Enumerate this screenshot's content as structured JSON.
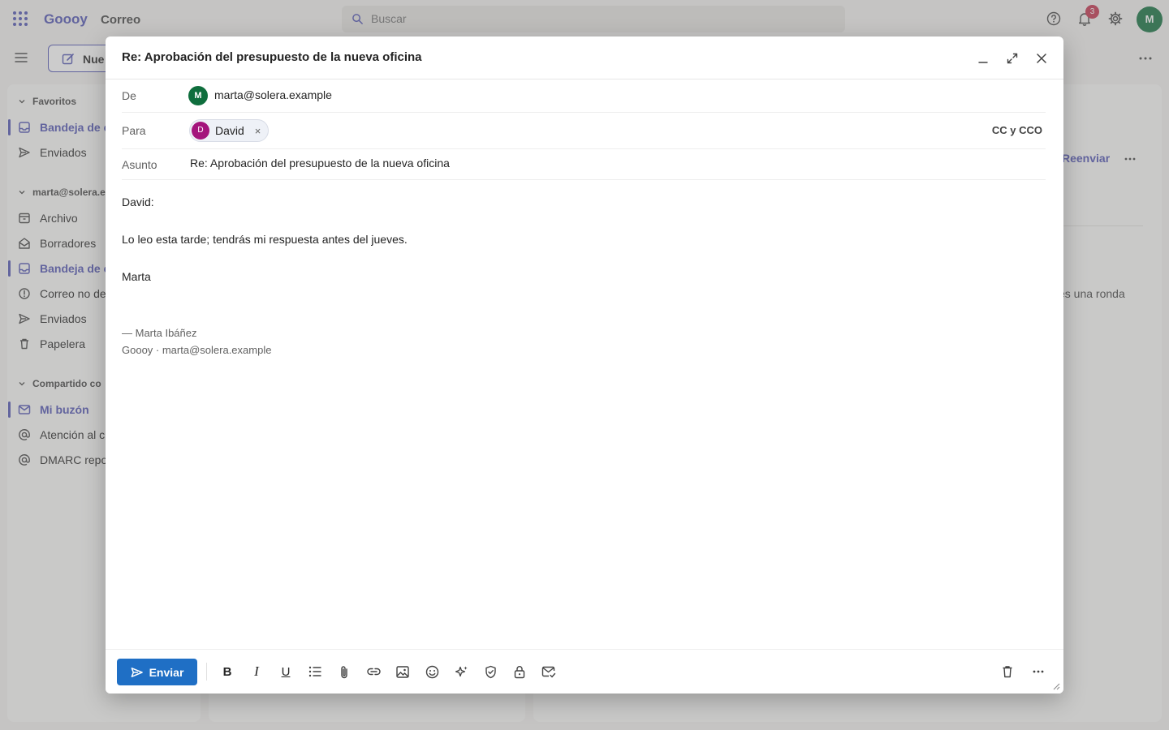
{
  "app": {
    "brand": "Goooy",
    "name": "Correo",
    "search_placeholder": "Buscar",
    "notifications_count": "3",
    "user_initial": "M",
    "new_button": "Nue"
  },
  "nav": {
    "favorites_header": "Favoritos",
    "favorites": [
      {
        "label": "Bandeja de e"
      },
      {
        "label": "Enviados"
      }
    ],
    "account_header": "marta@solera.e",
    "account_items": [
      {
        "label": "Archivo"
      },
      {
        "label": "Borradores"
      },
      {
        "label": "Bandeja de e"
      },
      {
        "label": "Correo no de"
      },
      {
        "label": "Enviados"
      },
      {
        "label": "Papelera"
      }
    ],
    "shared_header": "Compartido co",
    "shared_items": [
      {
        "label": "Mi buzón"
      },
      {
        "label": "Atención al cl"
      },
      {
        "label": "DMARC repor"
      }
    ]
  },
  "reading": {
    "forward": "Reenviar",
    "snippet": "es una ronda"
  },
  "compose": {
    "title": "Re: Aprobación del presupuesto de la nueva oficina",
    "from_label": "De",
    "from_initial": "M",
    "from_address": "marta@solera.example",
    "to_label": "Para",
    "recipient_initial": "D",
    "recipient_name": "David",
    "recipient_remove": "×",
    "cc_bcc": "CC y CCO",
    "subject_label": "Asunto",
    "subject": "Re: Aprobación del presupuesto de la nueva oficina",
    "body": {
      "greeting": "David:",
      "line1": "Lo leo esta tarde; tendrás mi respuesta antes del jueves.",
      "closing": "Marta"
    },
    "signature": {
      "line1": "— Marta Ibáñez",
      "line2": "Goooy · marta@solera.example"
    },
    "send_label": "Enviar",
    "toolbar": {
      "bold": "B",
      "italic": "I",
      "underline": "U"
    }
  },
  "colors": {
    "brand": "#4f52b2",
    "send": "#1f6fc5",
    "avatar_green": "#0f6e3d",
    "avatar_magenta": "#a4147c",
    "badge": "#c4314b"
  }
}
